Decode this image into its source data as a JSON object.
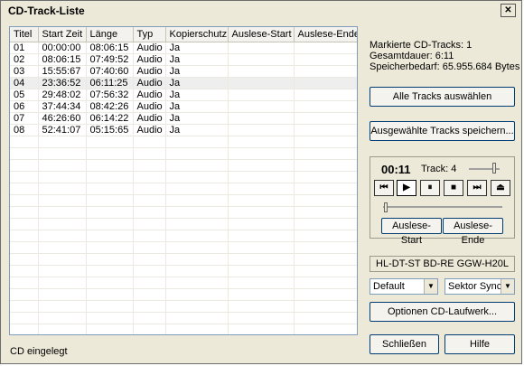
{
  "window": {
    "title": "CD-Track-Liste",
    "close_glyph": "✕"
  },
  "table": {
    "columns": [
      "Titel",
      "Start Zeit",
      "Länge",
      "Typ",
      "Kopierschutz",
      "Auslese-Start",
      "Auslese-Ende"
    ],
    "rows": [
      [
        "01",
        "00:00:00",
        "08:06:15",
        "Audio",
        "Ja",
        "",
        ""
      ],
      [
        "02",
        "08:06:15",
        "07:49:52",
        "Audio",
        "Ja",
        "",
        ""
      ],
      [
        "03",
        "15:55:67",
        "07:40:60",
        "Audio",
        "Ja",
        "",
        ""
      ],
      [
        "04",
        "23:36:52",
        "06:11:25",
        "Audio",
        "Ja",
        "",
        ""
      ],
      [
        "05",
        "29:48:02",
        "07:56:32",
        "Audio",
        "Ja",
        "",
        ""
      ],
      [
        "06",
        "37:44:34",
        "08:42:26",
        "Audio",
        "Ja",
        "",
        ""
      ],
      [
        "07",
        "46:26:60",
        "06:14:22",
        "Audio",
        "Ja",
        "",
        ""
      ],
      [
        "08",
        "52:41:07",
        "05:15:65",
        "Audio",
        "Ja",
        "",
        ""
      ]
    ],
    "selected_row": 3
  },
  "status": "CD eingelegt",
  "info": {
    "marked": "Markierte CD-Tracks: 1",
    "duration": "Gesamtdauer:  6:11",
    "storage": "Speicherbedarf: 65.955.684 Bytes"
  },
  "buttons": {
    "select_all": "Alle Tracks auswählen",
    "save_selected": "Ausgewählte Tracks speichern...",
    "read_start": "Auslese-Start",
    "read_end": "Auslese-Ende",
    "drive_options": "Optionen CD-Laufwerk...",
    "close": "Schließen",
    "help": "Hilfe"
  },
  "player": {
    "time": "00:11",
    "track_label": "Track: 4",
    "controls": [
      {
        "name": "previous-track-icon",
        "glyph": "⏮"
      },
      {
        "name": "play-icon",
        "glyph": "▶"
      },
      {
        "name": "pause-icon",
        "glyph": "⏸"
      },
      {
        "name": "stop-icon",
        "glyph": "■"
      },
      {
        "name": "next-track-icon",
        "glyph": "⏭"
      },
      {
        "name": "eject-icon",
        "glyph": "⏏"
      }
    ],
    "position_fraction": 0.02
  },
  "drive": {
    "name": "HL-DT-ST BD-RE  GGW-H20L"
  },
  "selects": {
    "mode": "Default",
    "sync": "Sektor Sync"
  }
}
